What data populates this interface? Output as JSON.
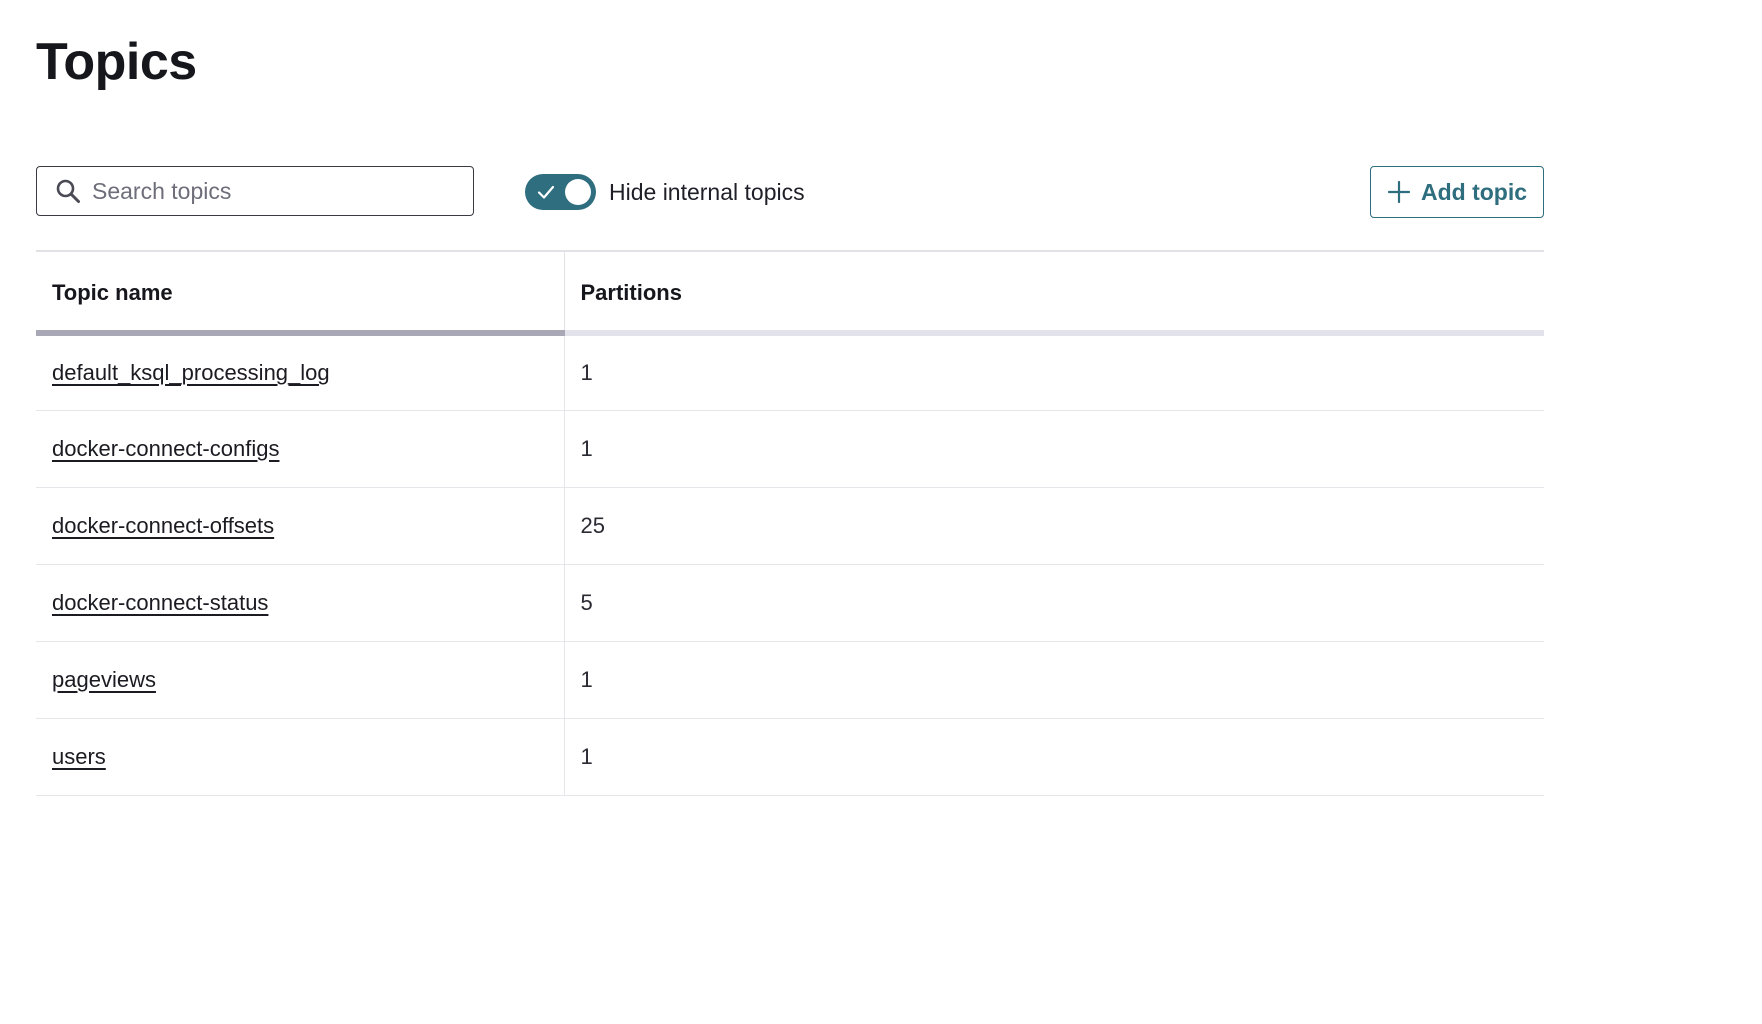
{
  "page": {
    "title": "Topics"
  },
  "search": {
    "placeholder": "Search topics",
    "value": ""
  },
  "toggle": {
    "label": "Hide internal topics",
    "checked": true
  },
  "actions": {
    "add_topic_label": "Add topic"
  },
  "table": {
    "columns": [
      "Topic name",
      "Partitions"
    ],
    "rows": [
      {
        "name": "default_ksql_processing_log",
        "partitions": "1"
      },
      {
        "name": "docker-connect-configs",
        "partitions": "1"
      },
      {
        "name": "docker-connect-offsets",
        "partitions": "25"
      },
      {
        "name": "docker-connect-status",
        "partitions": "5"
      },
      {
        "name": "pageviews",
        "partitions": "1"
      },
      {
        "name": "users",
        "partitions": "1"
      }
    ]
  },
  "colors": {
    "accent": "#2e6e7e",
    "text": "#1b1b22",
    "sort_indicator": "#a7a7b6"
  },
  "icons": {
    "search": "search-icon",
    "toggle_check": "check-icon",
    "add": "plus-icon"
  }
}
